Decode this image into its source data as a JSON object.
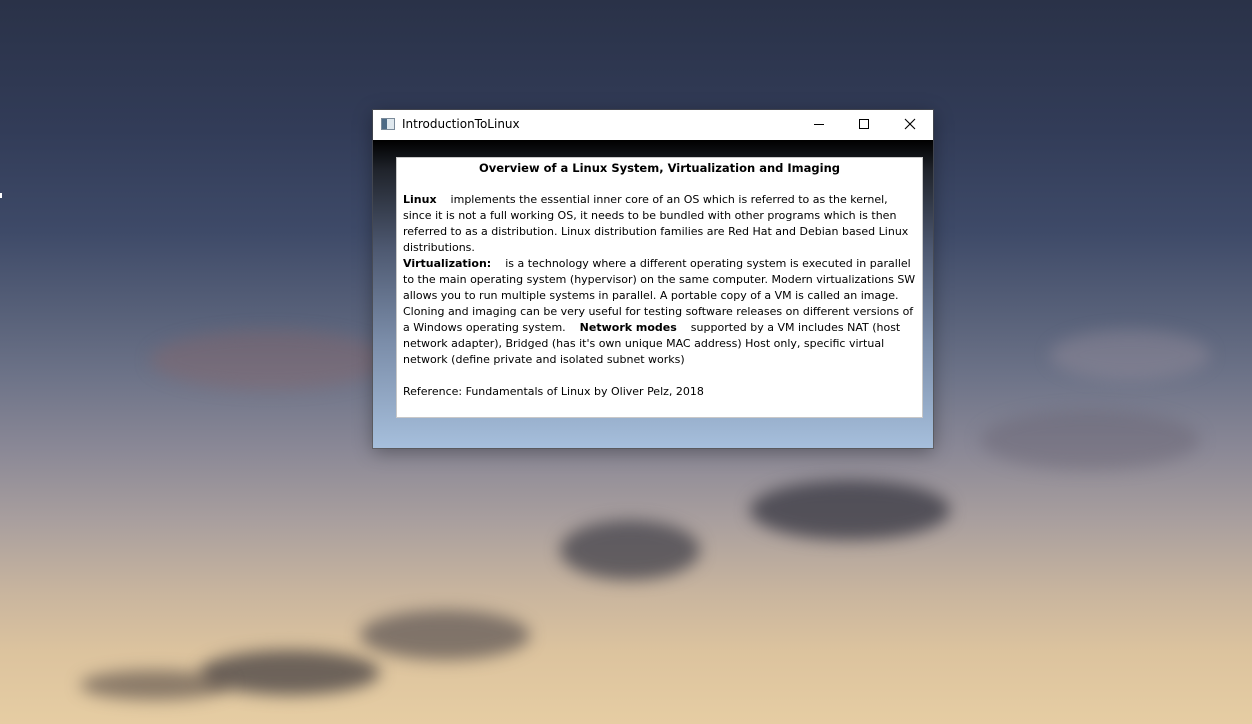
{
  "window": {
    "title": "IntroductionToLinux",
    "controls": {
      "minimize": "minimize-icon",
      "maximize": "maximize-icon",
      "close": "close-icon"
    }
  },
  "content": {
    "heading": "Overview of a Linux System, Virtualization and Imaging",
    "linux_term": "Linux",
    "linux_text": "implements the essential inner core of an OS which is referred to as the kernel, since it is not a full working OS, it needs to be bundled with other programs which is then referred to as a distribution. Linux distribution families are Red Hat and Debian based Linux distributions.",
    "virtualization_term": "Virtualization:",
    "virtualization_text": "is a technology where a different operating system is executed in parallel to the main operating system (hypervisor)  on the same computer. Modern virtualizations SW allows you to run multiple systems in parallel.  A portable copy of a VM is called an image. Cloning and imaging can be very useful for testing software releases on different versions of a Windows operating system.",
    "network_term": "Network modes",
    "network_text": "supported by a VM includes NAT (host network adapter), Bridged (has it's own unique MAC address) Host only, specific virtual network (define private and isolated subnet works)",
    "reference": "Reference: Fundamentals of Linux by Oliver Pelz, 2018"
  },
  "colors": {
    "panel_background": "#ffffff",
    "client_gradient_top": "#000000",
    "client_gradient_bottom": "#a6bfdc",
    "titlebar": "#ffffff"
  }
}
